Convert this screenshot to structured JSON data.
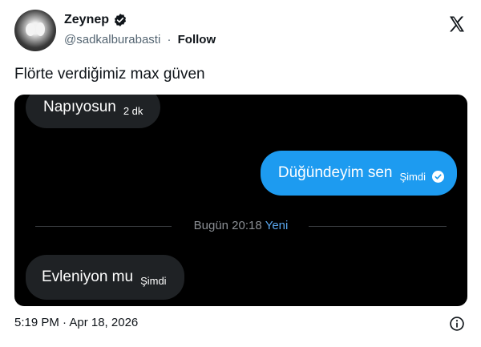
{
  "author": {
    "display_name": "Zeynep",
    "handle": "@sadkalburabasti",
    "separator": "·",
    "follow_label": "Follow",
    "verified_icon": "verified-badge-icon",
    "avatar": "profile-avatar"
  },
  "brand_icon": "x-logo-icon",
  "tweet": {
    "text": "Flörte verdiğimiz max güven",
    "timestamp": "5:19 PM · Apr 18, 2026"
  },
  "chat": {
    "messages": [
      {
        "direction": "incoming",
        "text": "Napıyosun",
        "time": "2 dk"
      },
      {
        "direction": "outgoing",
        "text": "Düğündeyim sen",
        "time": "Şimdi",
        "status_icon": "read-check-icon"
      },
      {
        "direction": "incoming",
        "text": "Evleniyon mu",
        "time": "Şimdi"
      }
    ],
    "divider": {
      "time": "Bugün 20:18",
      "tag": "Yeni"
    }
  },
  "colors": {
    "outgoing_bubble": "#1d9bf0",
    "incoming_bubble": "#1f2225",
    "chat_background": "#000000",
    "new_tag": "#5aa8f0"
  }
}
